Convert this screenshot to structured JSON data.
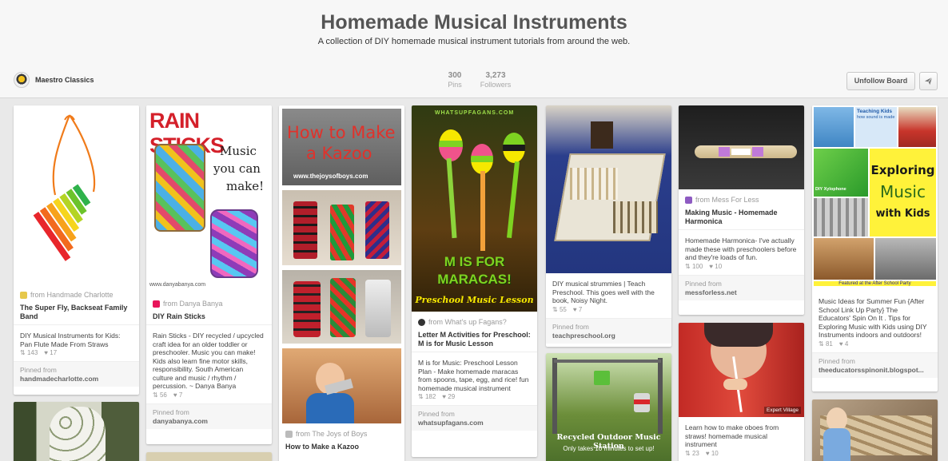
{
  "board": {
    "title": "Homemade Musical Instruments",
    "description": "A collection of DIY homemade musical instrument tutorials from around the web.",
    "owner": "Maestro Classics",
    "pins_count": "300",
    "pins_label": "Pins",
    "followers_count": "3,273",
    "followers_label": "Followers",
    "unfollow_label": "Unfollow Board",
    "send_icon": "paper-plane-icon"
  },
  "pins": [
    {
      "source": "from Handmade Charlotte",
      "title": "The Super Fly, Backseat Family Band",
      "description": "DIY Musical Instruments for Kids: Pan Flute Made From Straws",
      "repins": "143",
      "likes": "17",
      "pinned_from_label": "Pinned from",
      "pinned_from": "handmadecharlotte.com"
    },
    {
      "image_text": [
        "RAIN STICKS",
        "Music",
        "you can",
        "make!",
        "www.danyabanya.com"
      ],
      "source": "from Danya Banya",
      "title": "DIY Rain Sticks",
      "description": "Rain Sticks - DIY recycled / upcycled craft idea for an older toddler or preschooler. Music you can make! Kids also learn fine motor skills, responsibility. South American culture and music / rhythm / percussion. ~ Danya Banya",
      "repins": "56",
      "likes": "7",
      "pinned_from_label": "Pinned from",
      "pinned_from": "danyabanya.com"
    },
    {
      "image_text": [
        "How to Make",
        "a Kazoo",
        "www.thejoysofboys.com"
      ],
      "source": "from The Joys of Boys",
      "title": "How to Make a Kazoo"
    },
    {
      "image_text": [
        "WHATSUPFAGANS.COM",
        "M IS FOR",
        "MARACAS!",
        "Preschool Music Lesson"
      ],
      "source": "from What's up Fagans?",
      "title": "Letter M Activities for Preschool: M is for Music Lesson",
      "description": "M is for Music: Preschool Lesson Plan - Make homemade maracas from spoons, tape, egg, and rice! fun homemade musical instrument",
      "repins": "182",
      "likes": "29",
      "pinned_from_label": "Pinned from",
      "pinned_from": "whatsupfagans.com"
    },
    {
      "description": "DIY musical strummies | Teach Preschool. This goes well with the book, Noisy Night.",
      "repins": "55",
      "likes": "7",
      "pinned_from_label": "Pinned from",
      "pinned_from": "teachpreschool.org",
      "second_image_text": [
        "Recycled Outdoor Music Station",
        "Only takes 10 minutes to set up!"
      ]
    },
    {
      "source": "from Mess For Less",
      "title": "Making Music - Homemade Harmonica",
      "description": "Homemade Harmonica- I've actually made these with preschoolers before and they're loads of fun.",
      "repins": "100",
      "likes": "10",
      "pinned_from_label": "Pinned from",
      "pinned_from": "messforless.net",
      "second_image_badge": "Expert Village",
      "second_description": "Learn how to make oboes from straws! homemade musical instrument",
      "second_repins": "23",
      "second_likes": "10"
    },
    {
      "image_text": [
        "Teaching Kids",
        "how sound is made",
        "Exploring",
        "Music",
        "with Kids",
        "DIY Xylophone",
        "Featured at the After School Party"
      ],
      "description": "Music Ideas for Summer Fun {After School Link Up Party} The Educators' Spin On It . Tips for Exploring Music with Kids using DIY Instruments indoors and outdoors!",
      "repins": "81",
      "likes": "4",
      "pinned_from_label": "Pinned from",
      "pinned_from": "theeducatorsspinonit.blogspot..."
    }
  ],
  "colors": {
    "rain_red": "#d4202a",
    "kazoo_red": "#e0322b",
    "maracas_green": "#7ed321",
    "maracas_yellow": "#f6e800",
    "exploring_yellow": "#fff23a"
  }
}
